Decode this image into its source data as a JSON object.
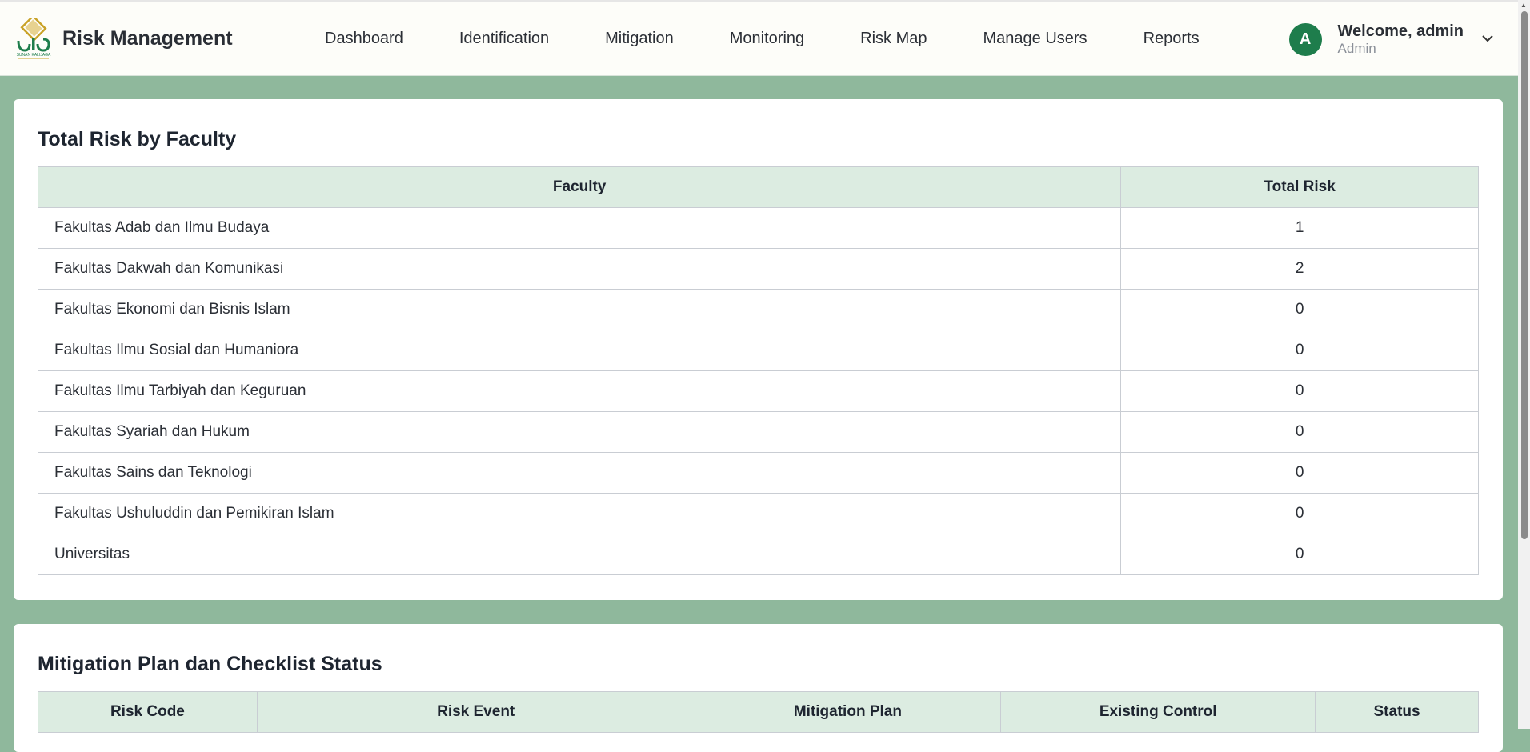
{
  "brand": {
    "title": "Risk Management",
    "logo_text": "SUNAN KALIJAGA"
  },
  "nav": [
    "Dashboard",
    "Identification",
    "Mitigation",
    "Monitoring",
    "Risk Map",
    "Manage Users",
    "Reports"
  ],
  "user": {
    "avatar_letter": "A",
    "welcome": "Welcome, admin",
    "role": "Admin"
  },
  "colors": {
    "accent": "#1e7d4c",
    "header_bg": "#dcece1",
    "page_bg": "#8fb89c"
  },
  "faculty_table": {
    "title": "Total Risk by Faculty",
    "headers": [
      "Faculty",
      "Total Risk"
    ],
    "rows": [
      [
        "Fakultas Adab dan Ilmu Budaya",
        "1"
      ],
      [
        "Fakultas Dakwah dan Komunikasi",
        "2"
      ],
      [
        "Fakultas Ekonomi dan Bisnis Islam",
        "0"
      ],
      [
        "Fakultas Ilmu Sosial dan Humaniora",
        "0"
      ],
      [
        "Fakultas Ilmu Tarbiyah dan Keguruan",
        "0"
      ],
      [
        "Fakultas Syariah dan Hukum",
        "0"
      ],
      [
        "Fakultas Sains dan Teknologi",
        "0"
      ],
      [
        "Fakultas Ushuluddin dan Pemikiran Islam",
        "0"
      ],
      [
        "Universitas",
        "0"
      ]
    ]
  },
  "mitigation_table": {
    "title": "Mitigation Plan dan Checklist Status",
    "headers": [
      "Risk Code",
      "Risk Event",
      "Mitigation Plan",
      "Existing Control",
      "Status"
    ]
  }
}
